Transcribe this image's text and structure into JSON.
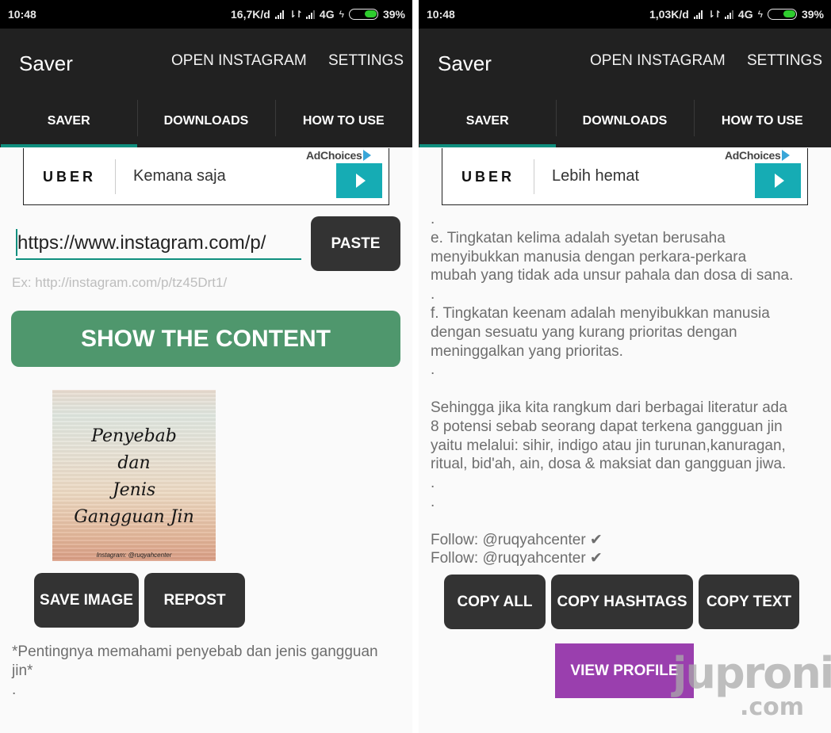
{
  "left": {
    "status": {
      "time": "10:48",
      "net_speed": "16,7K/d",
      "network": "4G",
      "battery": "39%",
      "battery_level": 0.39
    },
    "app_bar": {
      "title": "Saver",
      "actions": [
        "OPEN INSTAGRAM",
        "SETTINGS"
      ]
    },
    "tabs": [
      {
        "label": "SAVER",
        "active": true
      },
      {
        "label": "DOWNLOADS"
      },
      {
        "label": "HOW TO USE"
      }
    ],
    "ad": {
      "brand": "UBER",
      "slogan": "Kemana saja",
      "adchoices": "AdChoices"
    },
    "url_input": {
      "value": "https://www.instagram.com/p/",
      "hint": "Ex: http://instagram.com/p/tz45Drt1/"
    },
    "paste_label": "PASTE",
    "show_label": "SHOW THE CONTENT",
    "preview": {
      "lines": [
        "Penyebab",
        "dan",
        "Jenis",
        "Gangguan Jin"
      ],
      "credit": "Instagram: @ruqyahcenter"
    },
    "save_image_label": "SAVE IMAGE",
    "repost_label": "REPOST",
    "caption": "*Pentingnya memahami penyebab dan jenis gangguan jin*",
    "caption_dot": "."
  },
  "right": {
    "status": {
      "time": "10:48",
      "net_speed": "1,03K/d",
      "network": "4G",
      "battery": "39%",
      "battery_level": 0.39
    },
    "app_bar": {
      "title": "Saver",
      "actions": [
        "OPEN INSTAGRAM",
        "SETTINGS"
      ]
    },
    "tabs": [
      {
        "label": "SAVER",
        "active": true
      },
      {
        "label": "DOWNLOADS"
      },
      {
        "label": "HOW TO USE"
      }
    ],
    "ad": {
      "brand": "UBER",
      "slogan": "Lebih hemat",
      "adchoices": "AdChoices"
    },
    "body_text": ".\ne. Tingkatan kelima adalah syetan berusaha\nmenyibukkan manusia dengan perkara-perkara\nmubah yang tidak ada unsur pahala dan dosa di sana.\n.\nf. Tingkatan keenam adalah menyibukkan manusia\ndengan sesuatu yang kurang prioritas dengan\nmeninggalkan yang prioritas.\n.\n\nSehingga jika kita rangkum dari berbagai literatur ada\n8 potensi sebab seorang dapat terkena gangguan jin\nyaitu melalui: sihir, indigo atau jin turunan,kanuragan,\nritual, bid'ah, ain, dosa & maksiat dan gangguan jiwa.\n.\n.\n\nFollow: @ruqyahcenter ✔\nFollow: @ruqyahcenter ✔",
    "copy_all_label": "COPY ALL",
    "copy_hashtags_label": "COPY HASHTAGS",
    "copy_text_label": "COPY TEXT",
    "view_profile_label": "VIEW PROFILE"
  },
  "watermark": {
    "line1": "juproni",
    "line2": ".com"
  },
  "colors": {
    "app_bar": "#212121",
    "accent": "#0f8f7e",
    "show_button": "#4f976d",
    "dark_button": "#333333",
    "view_profile": "#9a3fae",
    "ad_play": "#16acb4"
  }
}
